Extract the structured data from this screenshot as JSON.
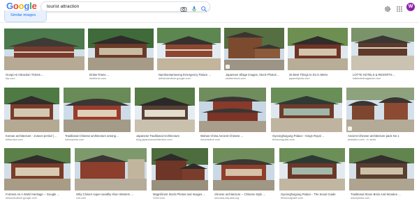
{
  "header": {
    "logo": {
      "letters": [
        "G",
        "o",
        "o",
        "g",
        "l",
        "e"
      ],
      "colors": [
        "#4285f4",
        "#ea4335",
        "#fbbc05",
        "#4285f4",
        "#34a853",
        "#ea4335"
      ]
    },
    "search_query": "tourist attraction",
    "icons": [
      "camera-icon",
      "microphone-icon",
      "search-icon",
      "gear-icon",
      "apps-grid-icon"
    ],
    "avatar_letter": "W",
    "avatar_color": "#8e24aa"
  },
  "tabs": {
    "similar_images": "Similar images",
    "active_color": "#1a73e8"
  },
  "results": [
    {
      "caption": "Gunpo-si Attraction Tickets ...",
      "source": "trip.com"
    },
    {
      "caption": "timber-frame ...",
      "source": "landforce.com"
    },
    {
      "caption": "Namhansanseong Emergency Palace ...",
      "source": "arttsandculture.google.com"
    },
    {
      "caption": "Japanese village images, Stock Photos ...",
      "source": "shutterstock.com"
    },
    {
      "caption": "25 Best Things to Do in Metro",
      "source": "japanobjects.com"
    },
    {
      "caption": "LOTTE HOTELS & RESORTS ...",
      "source": "lottehotelmagazine.com"
    },
    {
      "caption": "Korean architecture - Joseon period | ...",
      "source": "britannica.com"
    },
    {
      "caption": "Traditional Chinese architecture among ...",
      "source": "istockphoto.com"
    },
    {
      "caption": "Japanese Traditional Architecture",
      "source": "blog.japanesearchitecture.com"
    },
    {
      "caption": "Wuhan China Ancient Chinese ...",
      "source": "dreamstime.com"
    },
    {
      "caption": "Gyeonghuigung Palace - Kings Royal ...",
      "source": "theseoulguide.com"
    },
    {
      "caption": "Ancient Chinese architecture pack No 1",
      "source": "artstation.com · In stock"
    },
    {
      "caption": "Fortress As A World Heritage -- Google ...",
      "source": "artsandculture.google.com"
    },
    {
      "caption": "Why China's super wealthy shun Western ...",
      "source": "cnn.com"
    },
    {
      "caption": "Magnificent Stock Photos and Images ...",
      "source": "123rf.com"
    },
    {
      "caption": "chinese architecture -- Chinese Style ...",
      "source": "sea.asia-city.asia.org"
    },
    {
      "caption": "Gyeonghuigung Palace - The Seoul Guide",
      "source": "theseoulguide.com"
    },
    {
      "caption": "Traditional Stone Brick And Wooden ...",
      "source": "istockphoto.com"
    }
  ]
}
